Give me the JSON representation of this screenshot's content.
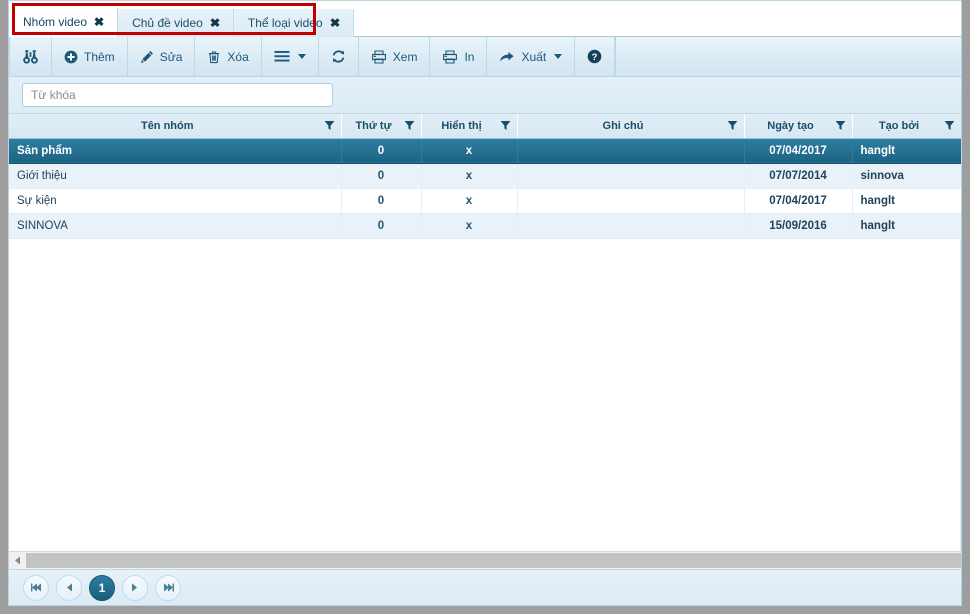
{
  "tabs": [
    {
      "label": "Nhóm video",
      "close": "✖",
      "active": true
    },
    {
      "label": "Chủ đề video",
      "close": "✖",
      "active": false
    },
    {
      "label": "Thể loại video",
      "close": "✖",
      "active": false
    }
  ],
  "toolbar": {
    "search_icon": "binoculars-icon",
    "add_label": "Thêm",
    "edit_label": "Sửa",
    "delete_label": "Xóa",
    "menu_icon": "hamburger-menu-icon",
    "refresh_icon": "refresh-icon",
    "view_label": "Xem",
    "print_label": "In",
    "export_label": "Xuất",
    "help_icon": "help-circle-icon"
  },
  "search": {
    "placeholder": "Từ khóa",
    "value": ""
  },
  "grid": {
    "columns": [
      {
        "key": "name",
        "label": "Tên nhóm"
      },
      {
        "key": "order",
        "label": "Thứ tự"
      },
      {
        "key": "show",
        "label": "Hiển thị"
      },
      {
        "key": "note",
        "label": "Ghi chú"
      },
      {
        "key": "date",
        "label": "Ngày tạo"
      },
      {
        "key": "author",
        "label": "Tạo bởi"
      }
    ],
    "rows": [
      {
        "name": "Sản phẩm",
        "order": "0",
        "show": "x",
        "note": "",
        "date": "07/04/2017",
        "author": "hanglt",
        "selected": true
      },
      {
        "name": "Giới thiệu",
        "order": "0",
        "show": "x",
        "note": "",
        "date": "07/07/2014",
        "author": "sinnova",
        "selected": false
      },
      {
        "name": "Sự kiện",
        "order": "0",
        "show": "x",
        "note": "",
        "date": "07/04/2017",
        "author": "hanglt",
        "selected": false
      },
      {
        "name": "SINNOVA",
        "order": "0",
        "show": "x",
        "note": "",
        "date": "15/09/2016",
        "author": "hanglt",
        "selected": false
      }
    ]
  },
  "pager": {
    "first": "⏮",
    "prev": "◀",
    "current_page": "1",
    "next": "▶",
    "last": "⏭"
  },
  "colors": {
    "accent": "#1d6382",
    "header_bg": "#d6e8f3",
    "selected_row": "#2d7ea3",
    "annotation": "#c00000"
  }
}
